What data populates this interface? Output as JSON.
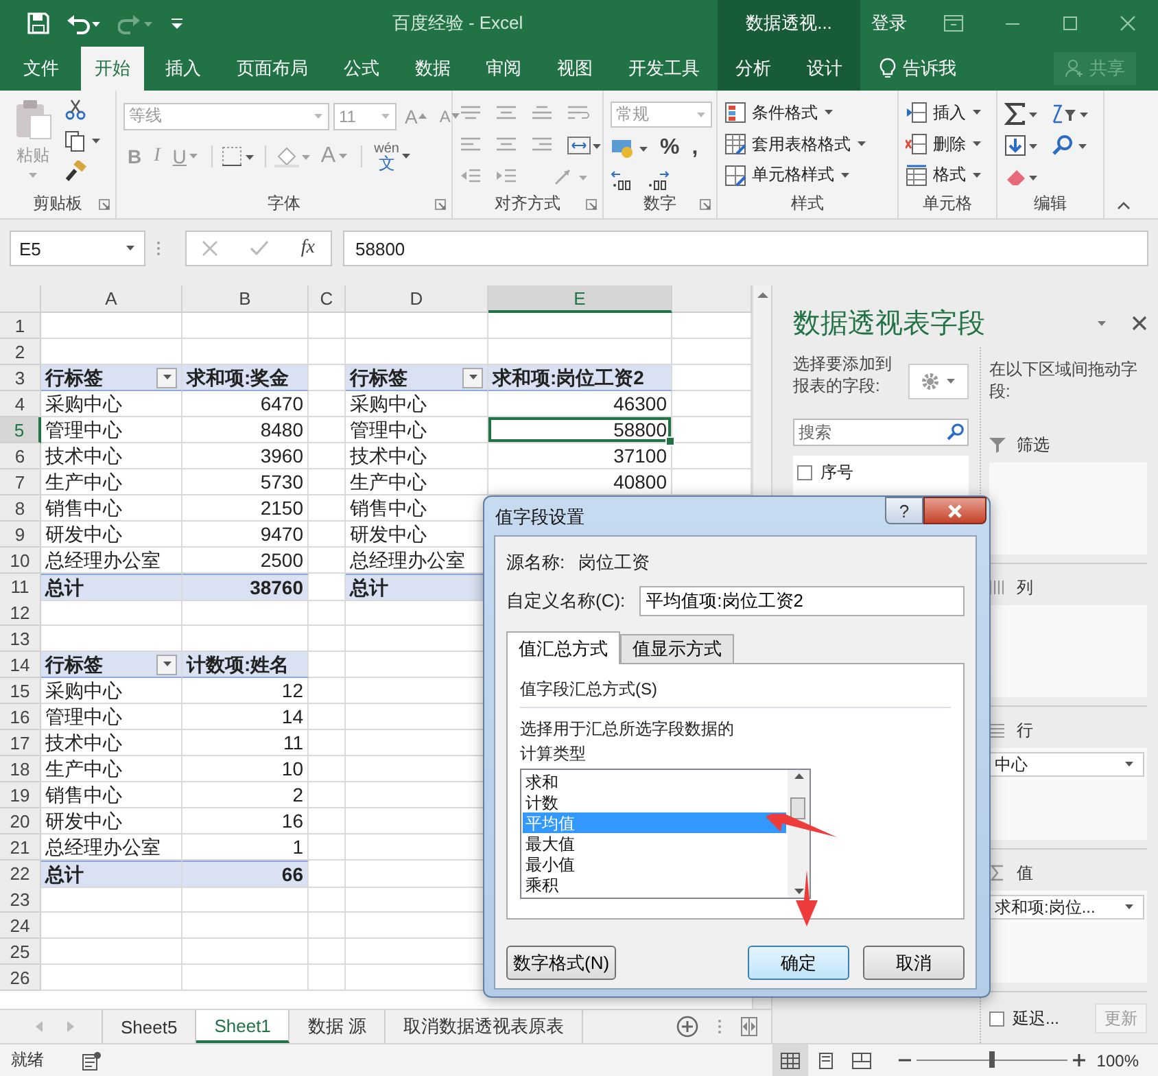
{
  "title_bar": {
    "title": "百度经验  -  Excel",
    "context_label": "数据透视...",
    "sign_in": "登录"
  },
  "tabs": [
    {
      "label": "文件",
      "selected": false,
      "contextual": false
    },
    {
      "label": "开始",
      "selected": true,
      "contextual": false
    },
    {
      "label": "插入",
      "selected": false,
      "contextual": false
    },
    {
      "label": "页面布局",
      "selected": false,
      "contextual": false
    },
    {
      "label": "公式",
      "selected": false,
      "contextual": false
    },
    {
      "label": "数据",
      "selected": false,
      "contextual": false
    },
    {
      "label": "审阅",
      "selected": false,
      "contextual": false
    },
    {
      "label": "视图",
      "selected": false,
      "contextual": false
    },
    {
      "label": "开发工具",
      "selected": false,
      "contextual": false
    },
    {
      "label": "分析",
      "selected": false,
      "contextual": true
    },
    {
      "label": "设计",
      "selected": false,
      "contextual": true
    }
  ],
  "tell_me": "告诉我",
  "share": "共享",
  "ribbon": {
    "groups": [
      {
        "kind": "clipboard",
        "label": "剪贴板",
        "launcher": true,
        "paste": "粘贴"
      },
      {
        "kind": "font",
        "label": "字体",
        "launcher": true,
        "font": "等线",
        "size": "11",
        "grow": "A",
        "shrink": "A",
        "styles": [
          {
            "kind": "bold",
            "label": "B"
          },
          {
            "kind": "italic",
            "label": "I"
          },
          {
            "kind": "underline",
            "label": "U"
          }
        ],
        "font_color": "A",
        "phonetic": "wén",
        "phonetic_char": "文"
      },
      {
        "kind": "alignment",
        "label": "对齐方式",
        "launcher": true
      },
      {
        "kind": "number",
        "label": "数字",
        "launcher": true,
        "format": "常规",
        "percent": "%",
        "comma": ","
      },
      {
        "kind": "styles",
        "label": "样式",
        "launcher": false,
        "commands": [
          "条件格式",
          "套用表格格式",
          "单元格样式"
        ]
      },
      {
        "kind": "cells",
        "label": "单元格",
        "launcher": false,
        "commands": [
          "插入",
          "删除",
          "格式"
        ]
      },
      {
        "kind": "editing",
        "label": "编辑",
        "launcher": false
      }
    ]
  },
  "formula_bar": {
    "name_box": "E5",
    "fx": "fx",
    "value": "58800"
  },
  "sheet": {
    "columns": [
      "A",
      "B",
      "C",
      "D",
      "E"
    ],
    "rows": [
      {
        "number": "1"
      },
      {
        "number": "2"
      },
      {
        "number": "3",
        "cells": {
          "A": {
            "kind": "header",
            "text": "行标签",
            "filter": true,
            "selected": false
          },
          "B": {
            "kind": "header",
            "text": "求和项:奖金",
            "filter": false,
            "selected": false
          },
          "D": {
            "kind": "header",
            "text": "行标签",
            "filter": true,
            "selected": false
          },
          "E": {
            "kind": "header",
            "text": "求和项:岗位工资2",
            "filter": false,
            "selected": false
          }
        }
      },
      {
        "number": "4",
        "cells": {
          "A": {
            "kind": "label",
            "text": "采购中心",
            "selected": false
          },
          "B": {
            "kind": "value",
            "text": "6470",
            "selected": false
          },
          "D": {
            "kind": "label",
            "text": "采购中心",
            "selected": false
          },
          "E": {
            "kind": "value",
            "text": "46300",
            "selected": false
          }
        }
      },
      {
        "number": "5",
        "cells": {
          "A": {
            "kind": "label",
            "text": "管理中心",
            "selected": false
          },
          "B": {
            "kind": "value",
            "text": "8480",
            "selected": false
          },
          "D": {
            "kind": "label",
            "text": "管理中心",
            "selected": false
          },
          "E": {
            "kind": "value",
            "text": "58800",
            "selected": true
          }
        }
      },
      {
        "number": "6",
        "cells": {
          "A": {
            "kind": "label",
            "text": "技术中心",
            "selected": false
          },
          "B": {
            "kind": "value",
            "text": "3960",
            "selected": false
          },
          "D": {
            "kind": "label",
            "text": "技术中心",
            "selected": false
          },
          "E": {
            "kind": "value",
            "text": "37100",
            "selected": false
          }
        }
      },
      {
        "number": "7",
        "cells": {
          "A": {
            "kind": "label",
            "text": "生产中心",
            "selected": false
          },
          "B": {
            "kind": "value",
            "text": "5730",
            "selected": false
          },
          "D": {
            "kind": "label",
            "text": "生产中心",
            "selected": false
          },
          "E": {
            "kind": "value",
            "text": "40800",
            "selected": false
          }
        }
      },
      {
        "number": "8",
        "cells": {
          "A": {
            "kind": "label",
            "text": "销售中心",
            "selected": false
          },
          "B": {
            "kind": "value",
            "text": "2150",
            "selected": false
          },
          "D": {
            "kind": "label",
            "text": "销售中心",
            "selected": false
          }
        }
      },
      {
        "number": "9",
        "cells": {
          "A": {
            "kind": "label",
            "text": "研发中心",
            "selected": false
          },
          "B": {
            "kind": "value",
            "text": "9470",
            "selected": false
          },
          "D": {
            "kind": "label",
            "text": "研发中心",
            "selected": false
          }
        }
      },
      {
        "number": "10",
        "cells": {
          "A": {
            "kind": "label",
            "text": "总经理办公室",
            "selected": false
          },
          "B": {
            "kind": "value",
            "text": "2500",
            "selected": false
          },
          "D": {
            "kind": "label",
            "text": "总经理办公室",
            "selected": false
          }
        }
      },
      {
        "number": "11",
        "cells": {
          "A": {
            "kind": "total_label",
            "text": "总计",
            "selected": false
          },
          "B": {
            "kind": "total_value",
            "text": "38760",
            "selected": false
          },
          "D": {
            "kind": "total_label",
            "text": "总计",
            "selected": false
          }
        }
      },
      {
        "number": "12"
      },
      {
        "number": "13"
      },
      {
        "number": "14",
        "cells": {
          "A": {
            "kind": "header",
            "text": "行标签",
            "filter": true,
            "selected": false
          },
          "B": {
            "kind": "header",
            "text": "计数项:姓名",
            "filter": false,
            "selected": false
          }
        }
      },
      {
        "number": "15",
        "cells": {
          "A": {
            "kind": "label",
            "text": "采购中心",
            "selected": false
          },
          "B": {
            "kind": "value",
            "text": "12",
            "selected": false
          }
        }
      },
      {
        "number": "16",
        "cells": {
          "A": {
            "kind": "label",
            "text": "管理中心",
            "selected": false
          },
          "B": {
            "kind": "value",
            "text": "14",
            "selected": false
          }
        }
      },
      {
        "number": "17",
        "cells": {
          "A": {
            "kind": "label",
            "text": "技术中心",
            "selected": false
          },
          "B": {
            "kind": "value",
            "text": "11",
            "selected": false
          }
        }
      },
      {
        "number": "18",
        "cells": {
          "A": {
            "kind": "label",
            "text": "生产中心",
            "selected": false
          },
          "B": {
            "kind": "value",
            "text": "10",
            "selected": false
          }
        }
      },
      {
        "number": "19",
        "cells": {
          "A": {
            "kind": "label",
            "text": "销售中心",
            "selected": false
          },
          "B": {
            "kind": "value",
            "text": "2",
            "selected": false
          }
        }
      },
      {
        "number": "20",
        "cells": {
          "A": {
            "kind": "label",
            "text": "研发中心",
            "selected": false
          },
          "B": {
            "kind": "value",
            "text": "16",
            "selected": false
          }
        }
      },
      {
        "number": "21",
        "cells": {
          "A": {
            "kind": "label",
            "text": "总经理办公室",
            "selected": false
          },
          "B": {
            "kind": "value",
            "text": "1",
            "selected": false
          }
        }
      },
      {
        "number": "22",
        "cells": {
          "A": {
            "kind": "total_label",
            "text": "总计",
            "selected": false
          },
          "B": {
            "kind": "total_value",
            "text": "66",
            "selected": false
          }
        }
      },
      {
        "number": "23"
      },
      {
        "number": "24"
      },
      {
        "number": "25"
      },
      {
        "number": "26"
      }
    ]
  },
  "sheet_tabs": [
    {
      "label": "Sheet5",
      "selected": false
    },
    {
      "label": "Sheet1",
      "selected": true
    },
    {
      "label": "数据 源",
      "selected": false
    },
    {
      "label": "取消数据透视表原表",
      "selected": false
    }
  ],
  "pane": {
    "title": "数据透视表字段",
    "choose_label": "选择要添加到报表的字段:",
    "search_placeholder": "搜索",
    "fields": [
      {
        "name": "序号",
        "checked": false
      }
    ],
    "drag_label": "在以下区域间拖动字段:",
    "areas": [
      {
        "kind": "filter",
        "label": "筛选"
      },
      {
        "kind": "columns",
        "label": "列"
      },
      {
        "kind": "rows",
        "label": "行",
        "chips": [
          "中心"
        ]
      },
      {
        "kind": "values",
        "label": "值",
        "chips": [
          "求和项:岗位..."
        ]
      }
    ],
    "defer": {
      "label": "延迟...",
      "checked": false
    },
    "update": "更新"
  },
  "dialog": {
    "title": "值字段设置",
    "help": "?",
    "source_label": "源名称:",
    "source_name": "岗位工资",
    "custom_label": "自定义名称(C):",
    "custom_value": "平均值项:岗位工资2",
    "tabs": [
      {
        "label": "值汇总方式",
        "selected": true
      },
      {
        "label": "值显示方式",
        "selected": false
      }
    ],
    "section": "值字段汇总方式(S)",
    "description": "选择用于汇总所选字段数据的计算类型",
    "options": [
      {
        "label": "求和",
        "selected": false
      },
      {
        "label": "计数",
        "selected": false
      },
      {
        "label": "平均值",
        "selected": true
      },
      {
        "label": "最大值",
        "selected": false
      },
      {
        "label": "最小值",
        "selected": false
      },
      {
        "label": "乘积",
        "selected": false
      }
    ],
    "buttons": [
      {
        "label": "数字格式(N)",
        "kind": "secondary"
      },
      {
        "label": "确定",
        "kind": "default"
      },
      {
        "label": "取消",
        "kind": "secondary"
      }
    ]
  },
  "status_bar": {
    "ready": "就绪",
    "views": [
      {
        "kind": "normal",
        "selected": true
      },
      {
        "kind": "page_layout",
        "selected": false
      },
      {
        "kind": "page_break",
        "selected": false
      }
    ],
    "zoom": {
      "level": 0.5,
      "reading": "100%"
    }
  }
}
